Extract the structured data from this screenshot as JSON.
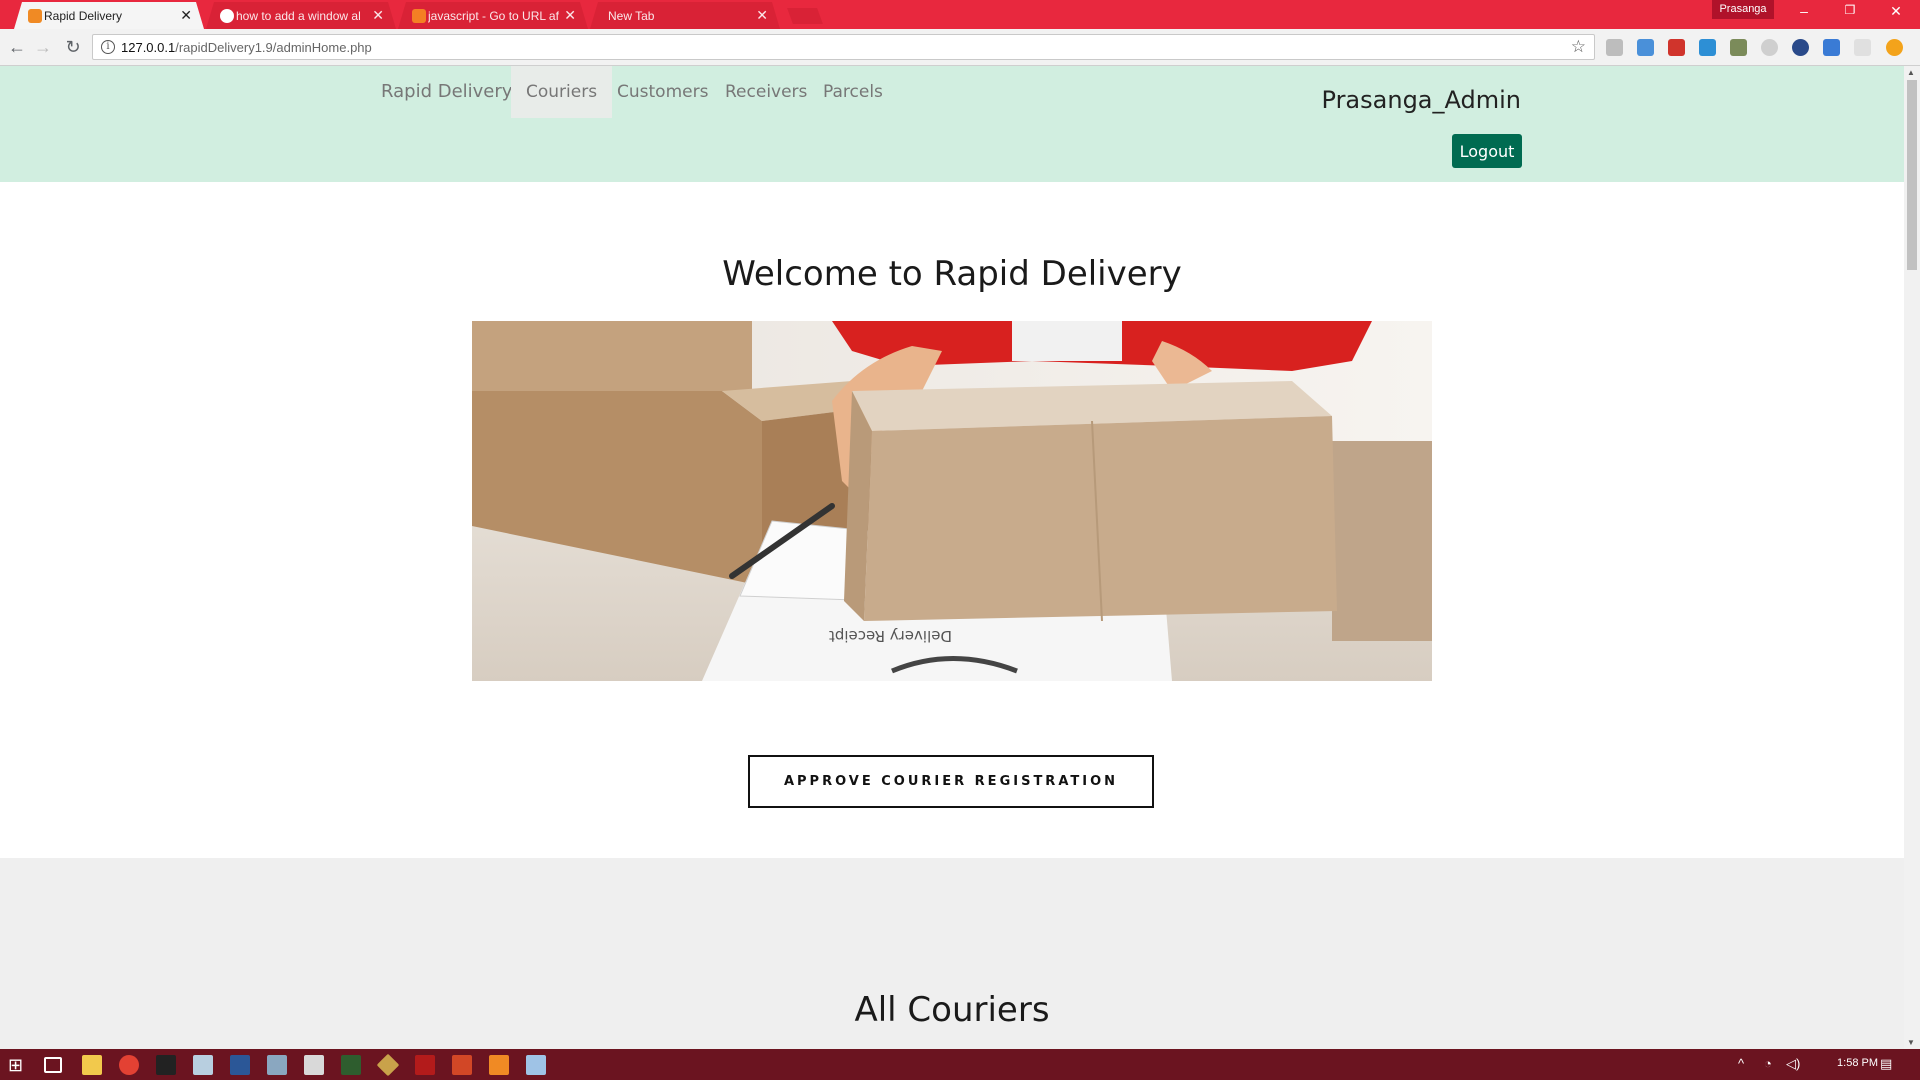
{
  "browser": {
    "tabs": [
      {
        "title": "Rapid Delivery",
        "active": true,
        "favicon_color": "#f08a24"
      },
      {
        "title": "how to add a window al",
        "active": false,
        "favicon_color": "#ffffff"
      },
      {
        "title": "javascript - Go to URL af",
        "active": false,
        "favicon_color": "#f48024"
      },
      {
        "title": "New Tab",
        "active": false,
        "favicon_color": ""
      }
    ],
    "profile": "Prasanga",
    "url_host": "127.0.0.1",
    "url_path": "/rapidDelivery1.9/adminHome.php"
  },
  "navbar": {
    "brand": "Rapid Delivery",
    "links": [
      "Couriers",
      "Customers",
      "Receivers",
      "Parcels"
    ],
    "active_link": "Couriers",
    "username": "Prasanga_Admin",
    "logout_label": "Logout"
  },
  "main": {
    "welcome_heading": "Welcome to Rapid Delivery",
    "approve_button_label": "APPROVE COURIER REGISTRATION",
    "hero_receipt_text": "Delivery Receipt"
  },
  "couriers_section": {
    "heading": "All Couriers"
  },
  "taskbar": {
    "time": "1:58 PM"
  },
  "colors": {
    "tab_bar": "#e8283e",
    "navbar_bg": "#d1eee0",
    "logout_bg": "#006b51",
    "taskbar_bg": "#6b1420"
  }
}
